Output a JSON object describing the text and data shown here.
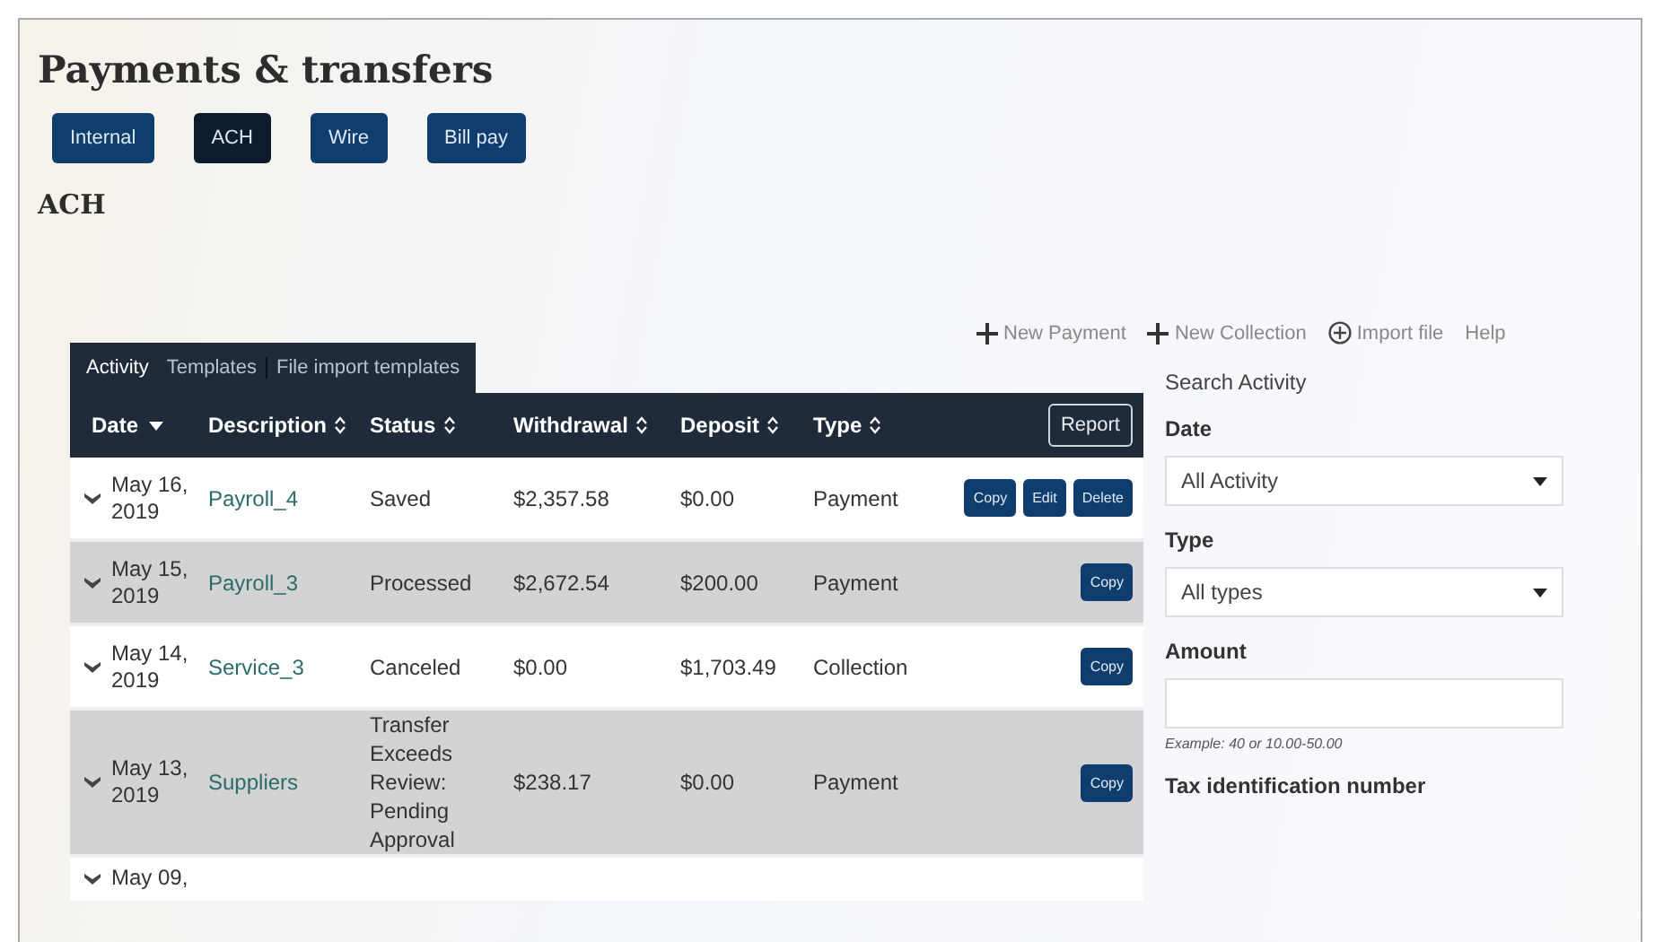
{
  "page": {
    "title": "Payments & transfers",
    "section_heading": "ACH"
  },
  "nav_buttons": [
    {
      "label": "Internal",
      "selected": false
    },
    {
      "label": "ACH",
      "selected": true
    },
    {
      "label": "Wire",
      "selected": false
    },
    {
      "label": "Bill pay",
      "selected": false
    }
  ],
  "tabs": [
    {
      "label": "Activity",
      "selected": true
    },
    {
      "label": "Templates",
      "selected": false
    },
    {
      "label": "File import templates",
      "selected": false
    }
  ],
  "actions": [
    {
      "kind": "plus",
      "label": "New Payment"
    },
    {
      "kind": "plus",
      "label": "New Collection"
    },
    {
      "kind": "circle-plus",
      "label": "Import file"
    },
    {
      "kind": "plain",
      "label": "Help"
    }
  ],
  "table": {
    "columns": [
      {
        "label": "Date",
        "sorted": true
      },
      {
        "label": "Description",
        "sorted": false
      },
      {
        "label": "Status",
        "sorted": false
      },
      {
        "label": "Withdrawal",
        "sorted": false
      },
      {
        "label": "Deposit",
        "sorted": false
      },
      {
        "label": "Type",
        "sorted": false
      }
    ],
    "report_button": "Report",
    "rows": [
      {
        "date": "May 16, 2019",
        "description": "Payroll_4",
        "status": "Saved",
        "withdrawal": "$2,357.58",
        "deposit": "$0.00",
        "type": "Payment",
        "buttons": [
          "Copy",
          "Edit",
          "Delete"
        ]
      },
      {
        "date": "May 15, 2019",
        "description": "Payroll_3",
        "status": "Processed",
        "withdrawal": "$2,672.54",
        "deposit": "$200.00",
        "type": "Payment",
        "buttons": [
          "Copy"
        ]
      },
      {
        "date": "May 14, 2019",
        "description": "Service_3",
        "status": "Canceled",
        "withdrawal": "$0.00",
        "deposit": "$1,703.49",
        "type": "Collection",
        "buttons": [
          "Copy"
        ]
      },
      {
        "date": "May 13, 2019",
        "description": "Suppliers",
        "status": "Transfer Exceeds Review: Pending Approval",
        "withdrawal": "$238.17",
        "deposit": "$0.00",
        "type": "Payment",
        "buttons": [
          "Copy"
        ]
      },
      {
        "date": "May 09,"
      }
    ]
  },
  "search": {
    "title": "Search Activity",
    "fields": [
      {
        "kind": "select",
        "label": "Date",
        "value": "All Activity"
      },
      {
        "kind": "select",
        "label": "Type",
        "value": "All types"
      },
      {
        "kind": "input",
        "label": "Amount",
        "hint": "Example: 40 or 10.00-50.00"
      },
      {
        "kind": "heading",
        "label": "Tax identification number"
      }
    ]
  }
}
